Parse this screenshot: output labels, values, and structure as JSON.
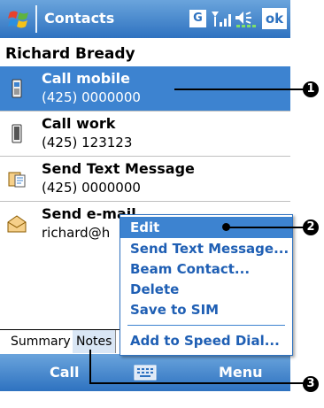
{
  "title_bar": {
    "app_title": "Contacts",
    "g_label": "G",
    "ok_label": "ok"
  },
  "contact": {
    "name": "Richard Bready"
  },
  "rows": [
    {
      "label": "Call mobile",
      "value": "(425) 0000000"
    },
    {
      "label": "Call work",
      "value": "(425) 123123"
    },
    {
      "label": "Send Text Message",
      "value": "(425) 0000000"
    },
    {
      "label": "Send e-mail",
      "value": "richard@h"
    }
  ],
  "context_menu": {
    "items": [
      "Edit",
      "Send Text Message...",
      "Beam Contact...",
      "Delete",
      "Save to SIM",
      "Add to Speed Dial..."
    ]
  },
  "tabs": [
    {
      "label": "Summary"
    },
    {
      "label": "Notes"
    }
  ],
  "menu_bar": {
    "left": "Call",
    "right": "Menu"
  },
  "callouts": [
    "1",
    "2",
    "3"
  ],
  "colors": {
    "title_blue": "#2e72c0",
    "selection": "#3d83d0"
  }
}
